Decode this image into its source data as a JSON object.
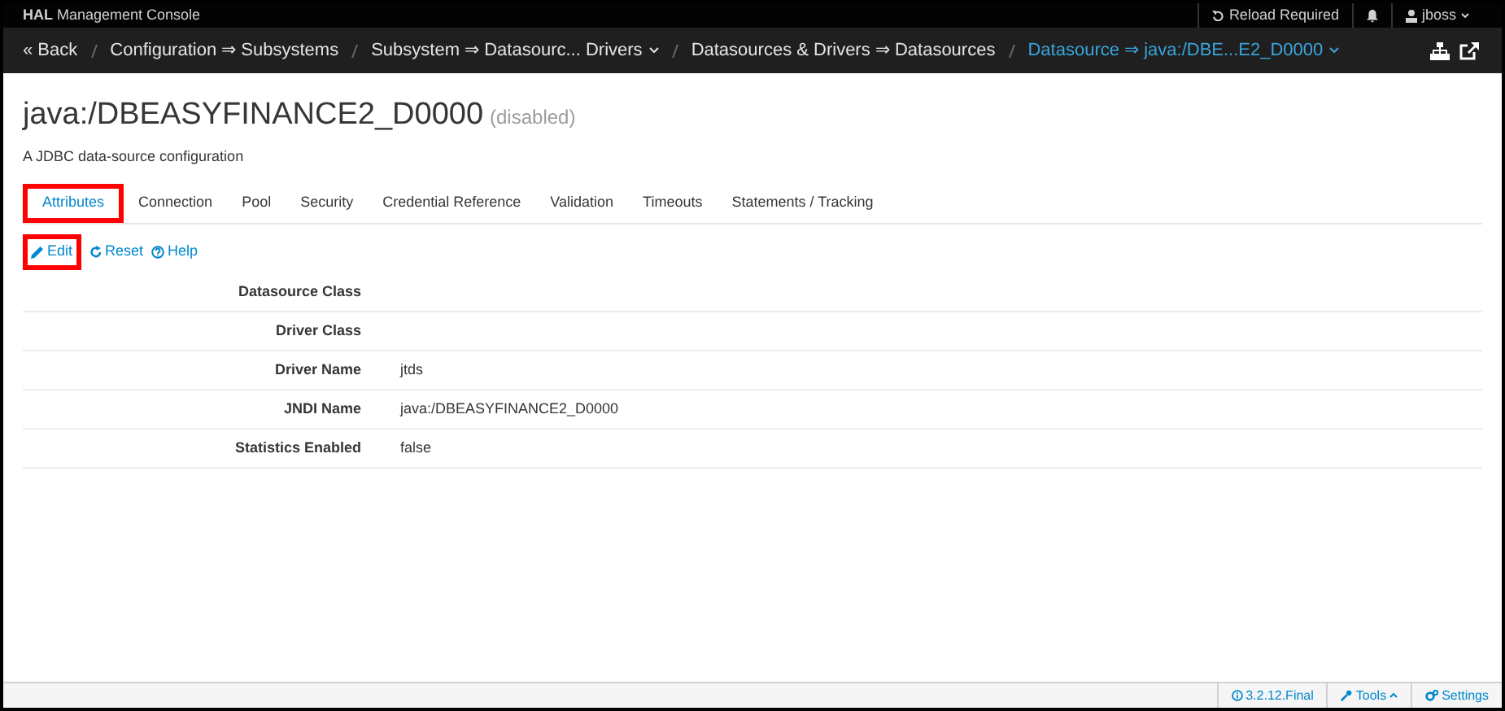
{
  "header": {
    "brand_bold": "HAL",
    "brand_rest": "Management Console",
    "reload": "Reload Required",
    "user": "jboss"
  },
  "breadcrumbs": [
    {
      "label": "« Back",
      "dropdown": false,
      "selected": false
    },
    {
      "label": "Configuration ⇒ Subsystems",
      "dropdown": false,
      "selected": false
    },
    {
      "label": "Subsystem ⇒ Datasourc... Drivers",
      "dropdown": true,
      "selected": false
    },
    {
      "label": "Datasources & Drivers ⇒ Datasources",
      "dropdown": false,
      "selected": false
    },
    {
      "label": "Datasource ⇒ java:/DBE...E2_D0000",
      "dropdown": true,
      "selected": true
    }
  ],
  "title": "java:/DBEASYFINANCE2_D0000",
  "title_state": "(disabled)",
  "description": "A JDBC data-source configuration",
  "tabs": [
    {
      "label": "Attributes",
      "selected": true,
      "highlighted": true
    },
    {
      "label": "Connection",
      "selected": false,
      "highlighted": false
    },
    {
      "label": "Pool",
      "selected": false,
      "highlighted": false
    },
    {
      "label": "Security",
      "selected": false,
      "highlighted": false
    },
    {
      "label": "Credential Reference",
      "selected": false,
      "highlighted": false
    },
    {
      "label": "Validation",
      "selected": false,
      "highlighted": false
    },
    {
      "label": "Timeouts",
      "selected": false,
      "highlighted": false
    },
    {
      "label": "Statements / Tracking",
      "selected": false,
      "highlighted": false
    }
  ],
  "actions": [
    {
      "kind": "edit",
      "label": "Edit",
      "highlighted": true
    },
    {
      "kind": "reset",
      "label": "Reset",
      "highlighted": false
    },
    {
      "kind": "help",
      "label": "Help",
      "highlighted": false
    }
  ],
  "attributes": [
    {
      "label": "Datasource Class"
    },
    {
      "label": "Driver Class"
    },
    {
      "label": "Driver Name",
      "value": "jtds"
    },
    {
      "label": "JNDI Name",
      "value": "java:/DBEASYFINANCE2_D0000"
    },
    {
      "label": "Statistics Enabled",
      "value": "false"
    }
  ],
  "footer": {
    "version": "3.2.12.Final",
    "tools": "Tools",
    "settings": "Settings"
  }
}
